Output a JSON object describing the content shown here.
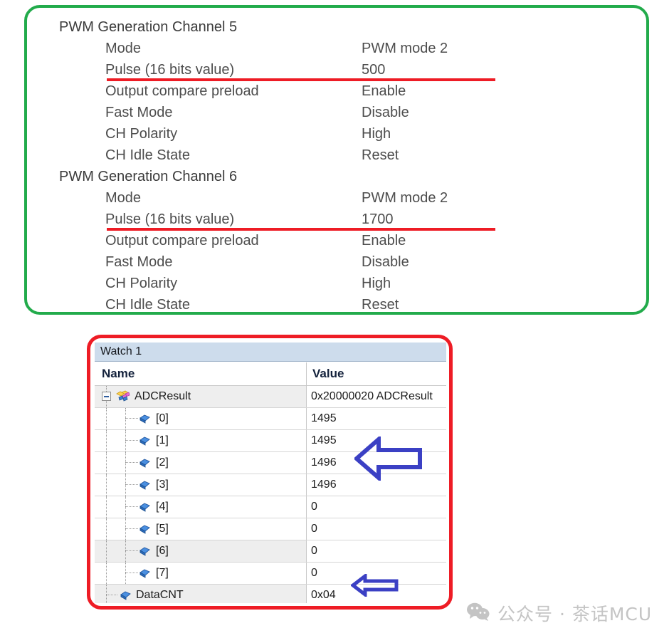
{
  "pwm_panel": {
    "highlight_color": "#22ab4b",
    "underline_color": "#ee1c25",
    "groups": [
      {
        "title": "PWM Generation Channel 5",
        "rows": [
          {
            "label": "Mode",
            "value": "PWM mode 2",
            "underlined": false
          },
          {
            "label": "Pulse (16 bits value)",
            "value": "500",
            "underlined": true
          },
          {
            "label": "Output compare preload",
            "value": "Enable",
            "underlined": false
          },
          {
            "label": "Fast Mode",
            "value": "Disable",
            "underlined": false
          },
          {
            "label": "CH Polarity",
            "value": "High",
            "underlined": false
          },
          {
            "label": "CH Idle State",
            "value": "Reset",
            "underlined": false
          }
        ]
      },
      {
        "title": "PWM Generation Channel 6",
        "rows": [
          {
            "label": "Mode",
            "value": "PWM mode 2",
            "underlined": false
          },
          {
            "label": "Pulse (16 bits value)",
            "value": "1700",
            "underlined": true
          },
          {
            "label": "Output compare preload",
            "value": "Enable",
            "underlined": false
          },
          {
            "label": "Fast Mode",
            "value": "Disable",
            "underlined": false
          },
          {
            "label": "CH Polarity",
            "value": "High",
            "underlined": false
          },
          {
            "label": "CH Idle State",
            "value": "Reset",
            "underlined": false
          }
        ]
      }
    ]
  },
  "watch_panel": {
    "highlight_color": "#ee1c25",
    "tab_label": "Watch 1",
    "columns": {
      "name": "Name",
      "value": "Value"
    },
    "rows": [
      {
        "name": "ADCResult",
        "value": "0x20000020 ADCResult",
        "level": 0,
        "icon": "struct-icon",
        "expander": "collapse-box",
        "shaded": true
      },
      {
        "name": "[0]",
        "value": "1495",
        "level": 2,
        "icon": "field-diamond-icon",
        "shaded": false
      },
      {
        "name": "[1]",
        "value": "1495",
        "level": 2,
        "icon": "field-diamond-icon",
        "shaded": false
      },
      {
        "name": "[2]",
        "value": "1496",
        "level": 2,
        "icon": "field-diamond-icon",
        "shaded": false
      },
      {
        "name": "[3]",
        "value": "1496",
        "level": 2,
        "icon": "field-diamond-icon",
        "shaded": false
      },
      {
        "name": "[4]",
        "value": "0",
        "level": 2,
        "icon": "field-diamond-icon",
        "shaded": false
      },
      {
        "name": "[5]",
        "value": "0",
        "level": 2,
        "icon": "field-diamond-icon",
        "shaded": false
      },
      {
        "name": "[6]",
        "value": "0",
        "level": 2,
        "icon": "field-diamond-icon",
        "shaded": true
      },
      {
        "name": "[7]",
        "value": "0",
        "level": 2,
        "icon": "field-diamond-icon",
        "shaded": false
      },
      {
        "name": "DataCNT",
        "value": "0x04",
        "level": 1,
        "icon": "field-diamond-icon",
        "shaded": true
      }
    ]
  },
  "annotations": {
    "arrow_color": "#3b40c4",
    "arrow_big_target": "1496",
    "arrow_small_target": "0x04"
  },
  "watermark": {
    "text": "公众号 · 茶话MCU",
    "color": "#c4c4c4"
  }
}
